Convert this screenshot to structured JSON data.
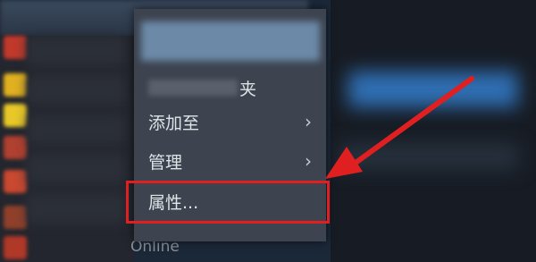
{
  "context_menu": {
    "item_1_label": "夹",
    "item_2_label": "添加至",
    "item_3_label": "管理",
    "item_4_label": "属性...",
    "submenu_chevron": "›"
  },
  "friends": {
    "status_label": "Online"
  },
  "colors": {
    "highlight": "#e02020",
    "menu_bg": "#3d4450",
    "page_bg": "#1b2838"
  }
}
